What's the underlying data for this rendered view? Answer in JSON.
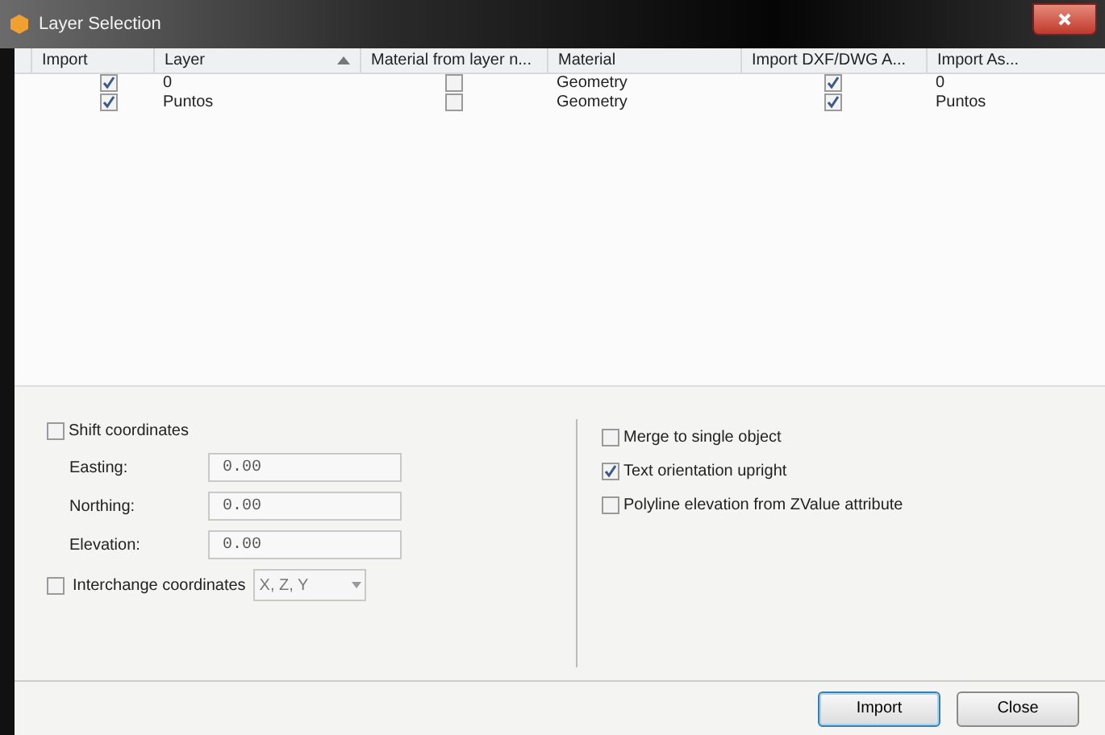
{
  "window": {
    "title": "Layer Selection"
  },
  "table": {
    "columns": [
      {
        "label": "Import",
        "sorted": false
      },
      {
        "label": "Layer",
        "sorted": true
      },
      {
        "label": "Material from layer n...",
        "sorted": false
      },
      {
        "label": "Material",
        "sorted": false
      },
      {
        "label": "Import DXF/DWG A...",
        "sorted": false
      },
      {
        "label": "Import As...",
        "sorted": false
      }
    ],
    "rows": [
      {
        "import": true,
        "layer": "0",
        "material_from_layer_name": false,
        "material": "Geometry",
        "import_dxf_dwg": true,
        "import_as": "0"
      },
      {
        "import": true,
        "layer": "Puntos",
        "material_from_layer_name": false,
        "material": "Geometry",
        "import_dxf_dwg": true,
        "import_as": "Puntos"
      }
    ]
  },
  "shift_coordinates": {
    "label": "Shift coordinates",
    "checked": false
  },
  "coordinate_fields": [
    {
      "label": "Easting:",
      "value": "0.00",
      "disabled": true
    },
    {
      "label": "Northing:",
      "value": "0.00",
      "disabled": true
    },
    {
      "label": "Elevation:",
      "value": "0.00",
      "disabled": true
    }
  ],
  "interchange_coordinates": {
    "label": "Interchange coordinates",
    "checked": false,
    "value": "X, Z, Y",
    "disabled": true
  },
  "options": [
    {
      "label": "Merge to single object",
      "checked": false
    },
    {
      "label": "Text orientation upright",
      "checked": true
    },
    {
      "label": "Polyline elevation from ZValue attribute",
      "checked": false
    }
  ],
  "buttons": [
    {
      "label": "Import",
      "default": true
    },
    {
      "label": "Close",
      "default": false
    }
  ]
}
